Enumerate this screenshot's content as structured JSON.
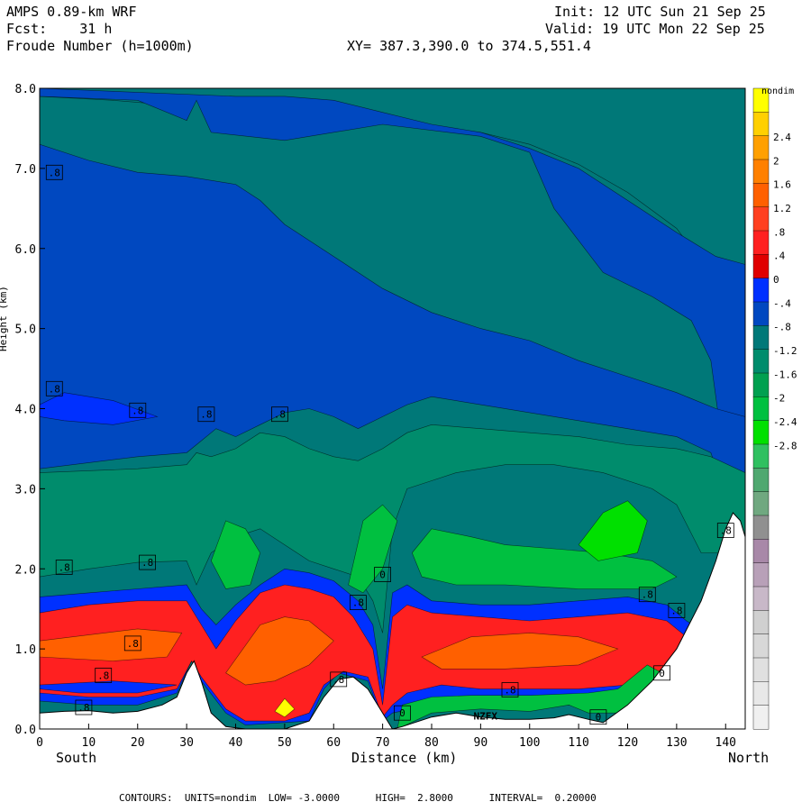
{
  "header": {
    "model": "AMPS 0.89-km WRF",
    "fcst": "Fcst:    31 h",
    "field": "Froude Number (h=1000m)",
    "init": "Init: 12 UTC Sun 21 Sep 25",
    "valid": "Valid: 19 UTC Mon 22 Sep 25",
    "xy": "XY= 387.3,390.0 to 374.5,551.4"
  },
  "chart_data": {
    "type": "heatmap",
    "title": "Froude Number (h=1000m)",
    "xlabel": "Distance (km)",
    "ylabel": "Height (km)",
    "x_left_label": "South",
    "x_right_label": "North",
    "xlim": [
      0,
      144
    ],
    "ylim": [
      0,
      8
    ],
    "x_ticks": [
      0,
      10,
      20,
      30,
      40,
      50,
      60,
      70,
      80,
      90,
      100,
      110,
      120,
      130,
      140
    ],
    "y_ticks": [
      "0.0",
      "1.0",
      "2.0",
      "3.0",
      "4.0",
      "5.0",
      "6.0",
      "7.0",
      "8.0"
    ],
    "units": "nondim",
    "colorbar_ticks": [
      "2.4",
      "2",
      "1.6",
      "1.2",
      ".8",
      ".4",
      "0",
      "-.4",
      "-.8",
      "-1.2",
      "-1.6",
      "-2",
      "-2.4",
      "-2.8"
    ],
    "colorbar_colors": [
      "#ffff00",
      "#ffd000",
      "#ffa000",
      "#ff8000",
      "#ff6000",
      "#ff4020",
      "#ff2020",
      "#e00000",
      "#0030ff",
      "#0048c0",
      "#007878",
      "#008c6c",
      "#00a050",
      "#00c040",
      "#00e000",
      "#30c060",
      "#50a870",
      "#70a880",
      "#909090",
      "#a888a8",
      "#b8a0b8",
      "#c8b8c8",
      "#d0d0d0",
      "#d8d8d8",
      "#e0e0e0",
      "#e8e8e8",
      "#f0f0f0"
    ],
    "terrain": [
      [
        0,
        0.2
      ],
      [
        5,
        0.22
      ],
      [
        10,
        0.23
      ],
      [
        15,
        0.2
      ],
      [
        20,
        0.22
      ],
      [
        25,
        0.3
      ],
      [
        28,
        0.4
      ],
      [
        30,
        0.7
      ],
      [
        31.5,
        0.85
      ],
      [
        33,
        0.6
      ],
      [
        35,
        0.2
      ],
      [
        38,
        0.03
      ],
      [
        42,
        0.0
      ],
      [
        50,
        0.0
      ],
      [
        55,
        0.1
      ],
      [
        58,
        0.4
      ],
      [
        61,
        0.62
      ],
      [
        64,
        0.65
      ],
      [
        67,
        0.5
      ],
      [
        70,
        0.2
      ],
      [
        72,
        0.0
      ],
      [
        74,
        0.03
      ],
      [
        80,
        0.15
      ],
      [
        85,
        0.2
      ],
      [
        90,
        0.15
      ],
      [
        95,
        0.12
      ],
      [
        100,
        0.12
      ],
      [
        105,
        0.14
      ],
      [
        108,
        0.18
      ],
      [
        112,
        0.12
      ],
      [
        115,
        0.08
      ],
      [
        120,
        0.3
      ],
      [
        125,
        0.6
      ],
      [
        130,
        1.0
      ],
      [
        135,
        1.6
      ],
      [
        138,
        2.1
      ],
      [
        140,
        2.5
      ],
      [
        141.5,
        2.7
      ],
      [
        143,
        2.6
      ],
      [
        144,
        2.4
      ]
    ],
    "contour_labels": [
      {
        "x": 3,
        "y": 6.95,
        "text": ".8"
      },
      {
        "x": 3,
        "y": 4.25,
        "text": ".8"
      },
      {
        "x": 20,
        "y": 3.98,
        "text": ".8"
      },
      {
        "x": 34,
        "y": 3.93,
        "text": ".8"
      },
      {
        "x": 49,
        "y": 3.93,
        "text": ".8"
      },
      {
        "x": 5,
        "y": 2.02,
        "text": ".8"
      },
      {
        "x": 22,
        "y": 2.08,
        "text": ".8"
      },
      {
        "x": 70,
        "y": 1.93,
        "text": "0"
      },
      {
        "x": 65,
        "y": 1.58,
        "text": ".8"
      },
      {
        "x": 124,
        "y": 1.68,
        "text": ".8"
      },
      {
        "x": 130,
        "y": 1.48,
        "text": ".8"
      },
      {
        "x": 140,
        "y": 2.48,
        "text": ".8"
      },
      {
        "x": 19,
        "y": 1.07,
        "text": ".8"
      },
      {
        "x": 13,
        "y": 0.67,
        "text": ".8"
      },
      {
        "x": 9,
        "y": 0.27,
        "text": ".8"
      },
      {
        "x": 61,
        "y": 0.62,
        "text": ".8"
      },
      {
        "x": 96,
        "y": 0.49,
        "text": ".8"
      },
      {
        "x": 74,
        "y": 0.2,
        "text": "0"
      },
      {
        "x": 114,
        "y": 0.15,
        "text": "0"
      },
      {
        "x": 127,
        "y": 0.7,
        "text": "0"
      }
    ],
    "station": {
      "x": 91,
      "y": 0.12,
      "text": "NZFX"
    },
    "footer": "CONTOURS:  UNITS=nondim  LOW= -3.0000      HIGH=  2.8000      INTERVAL=  0.20000"
  }
}
